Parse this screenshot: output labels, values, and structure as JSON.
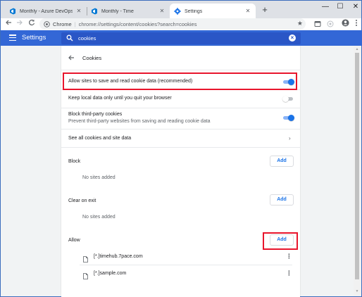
{
  "tabs": [
    {
      "label": "Monthly - Azure DevOps Services",
      "close": "✕"
    },
    {
      "label": "Monthly - Time",
      "close": "✕"
    },
    {
      "label": "Settings",
      "close": "✕"
    }
  ],
  "new_tab": "+",
  "window": {
    "minimize": "—",
    "maximize": "☐",
    "close": "✕"
  },
  "omnibox": {
    "scheme_label": "Chrome",
    "separator": "|",
    "url": "chrome://settings/content/cookies?search=cookies"
  },
  "header": {
    "title": "Settings",
    "search_value": "cookies"
  },
  "card": {
    "title": "Cookies",
    "rows": [
      {
        "label": "Allow sites to save and read cookie data (recommended)",
        "toggle": "on"
      },
      {
        "label": "Keep local data only until you quit your browser",
        "toggle": "off"
      },
      {
        "label": "Block third-party cookies",
        "sublabel": "Prevent third-party websites from saving and reading cookie data",
        "toggle": "on"
      },
      {
        "label": "See all cookies and site data"
      }
    ],
    "sections": {
      "block": {
        "label": "Block",
        "add": "Add",
        "empty": "No sites added"
      },
      "clear_on_exit": {
        "label": "Clear on exit",
        "add": "Add",
        "empty": "No sites added"
      },
      "allow": {
        "label": "Allow",
        "add": "Add",
        "sites": [
          "[*.]timehub.7pace.com",
          "[*.]sample.com"
        ]
      }
    }
  },
  "colors": {
    "accent": "#1a73e8",
    "header_bg": "#3367d6",
    "highlight": "#e8152c"
  }
}
